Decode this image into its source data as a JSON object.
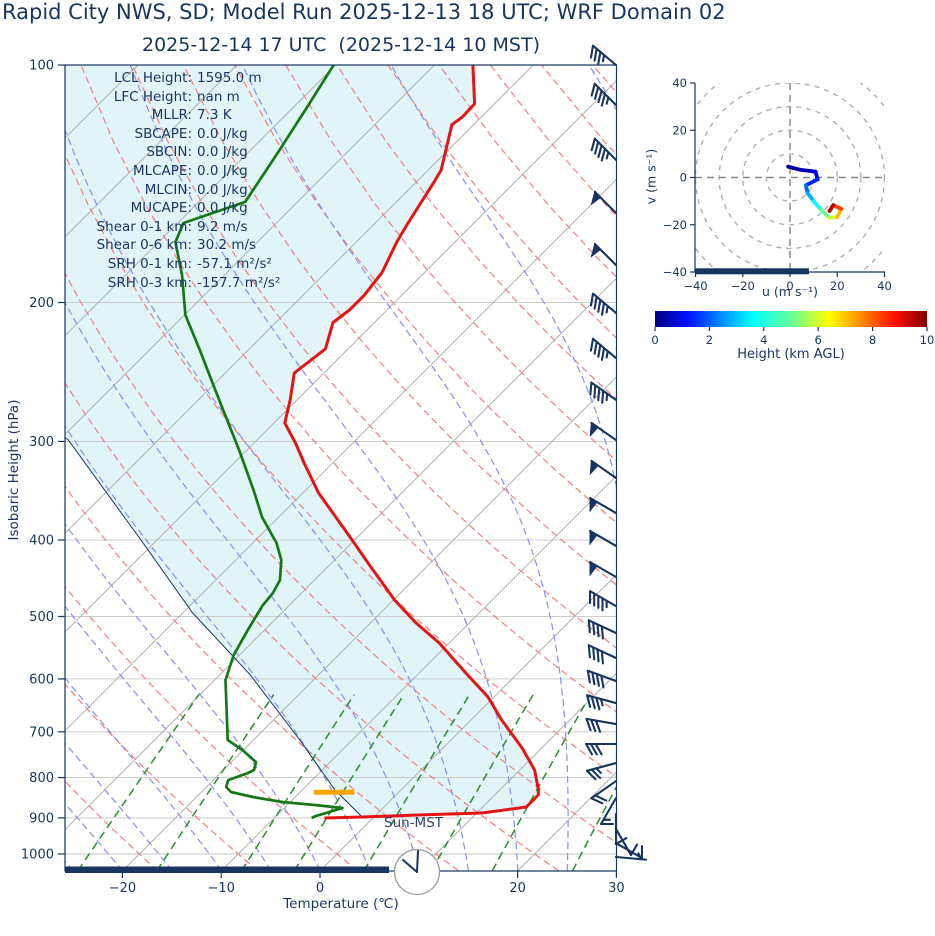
{
  "title": "Rapid City NWS, SD; Model Run 2025-12-13 18 UTC; WRF Domain 02",
  "subtitle": "2025-12-14 17 UTC  (2025-12-14 10 MST)",
  "skewt": {
    "xlabel": "Temperature (℃)",
    "ylabel": "Isobaric Height (hPa)",
    "x_ticks": [
      -20,
      -10,
      0,
      10,
      20,
      30
    ],
    "y_ticks": [
      100,
      200,
      300,
      400,
      500,
      600,
      700,
      800,
      900,
      1000
    ],
    "sun_label": "Sun-MST",
    "stats": [
      {
        "label": "LCL Height:",
        "value": "1595.0 m"
      },
      {
        "label": "LFC Height:",
        "value": "nan m"
      },
      {
        "label": "MLLR:",
        "value": "7.3 K"
      },
      {
        "label": "SBCAPE:",
        "value": "0.0 J/kg"
      },
      {
        "label": "SBCIN:",
        "value": "0.0 J/kg"
      },
      {
        "label": "MLCAPE:",
        "value": "0.0 J/kg"
      },
      {
        "label": "MLCIN:",
        "value": "0.0 J/kg"
      },
      {
        "label": "MUCAPE:",
        "value": "0.0 J/kg"
      },
      {
        "label": "Shear 0-1 km:",
        "value": "9.2 m/s"
      },
      {
        "label": "Shear 0-6 km:",
        "value": "30.2 m/s"
      },
      {
        "label": "SRH 0-1 km:",
        "value": "-57.1 m²/s²"
      },
      {
        "label": "SRH 0-3 km:",
        "value": "-157.7 m²/s²"
      }
    ]
  },
  "hodo": {
    "xlabel": "u (m s⁻¹)",
    "ylabel": "v (m s⁻¹)",
    "ticks": [
      -40,
      -20,
      0,
      20,
      40
    ],
    "range": [
      -40,
      40
    ]
  },
  "colorbar": {
    "ticks": [
      0,
      2,
      4,
      6,
      8,
      10
    ],
    "label": "Height (km AGL)",
    "min": 0,
    "max": 10
  },
  "colors": {
    "navy": "#17355e",
    "fill": "#e1f5f8",
    "isotherm": "#a9a9a9",
    "gridline": "#c6c6c6",
    "dry_adiabat": "#f08080",
    "moist_adiabat": "#8890e8",
    "mixing_line": "#2e8b2e",
    "temperature": "#e51412",
    "dewpoint": "#157815",
    "parcel": "#17355e",
    "lcl": "#ffa500",
    "clock_stroke": "#9a9a9a"
  },
  "chart_data": {
    "type": "line",
    "subtype": "skewt-sounding",
    "pressure_range_hPa": [
      100,
      1050
    ],
    "temp_axis_C": [
      -20,
      -10,
      0,
      10,
      20,
      30
    ],
    "temperature_C": [
      [
        100,
        -66.1
      ],
      [
        112,
        -62.0
      ],
      [
        116.4,
        -61.9
      ],
      [
        119,
        -62.2
      ],
      [
        135.8,
        -58.7
      ],
      [
        140.6,
        -58.2
      ],
      [
        159.5,
        -56.6
      ],
      [
        167.6,
        -55.9
      ],
      [
        183.2,
        -54.3
      ],
      [
        195.7,
        -53.8
      ],
      [
        204.4,
        -53.8
      ],
      [
        212,
        -54.2
      ],
      [
        228.9,
        -52.3
      ],
      [
        245.7,
        -53.0
      ],
      [
        265.7,
        -50.7
      ],
      [
        284.3,
        -48.9
      ],
      [
        301.4,
        -45.8
      ],
      [
        319.5,
        -42.9
      ],
      [
        348.7,
        -38.4
      ],
      [
        397.6,
        -30.6
      ],
      [
        430,
        -26.0
      ],
      [
        476.4,
        -19.9
      ],
      [
        509.5,
        -15.4
      ],
      [
        540.3,
        -11.0
      ],
      [
        589.5,
        -5.3
      ],
      [
        632.5,
        -0.6
      ],
      [
        676.4,
        3.1
      ],
      [
        733.9,
        8.0
      ],
      [
        782.7,
        11.5
      ],
      [
        829.5,
        13.9
      ],
      [
        841.8,
        14.4
      ],
      [
        871.8,
        14.4
      ],
      [
        887.3,
        10.5
      ],
      [
        892.6,
        3.9
      ],
      [
        897.6,
        -1.2
      ],
      [
        900.4,
        -4.9
      ]
    ],
    "dewpoint_C": [
      [
        100,
        -80.2
      ],
      [
        112.4,
        -78.7
      ],
      [
        128.9,
        -77.0
      ],
      [
        149.1,
        -75.3
      ],
      [
        158.6,
        -79.4
      ],
      [
        167.6,
        -78.3
      ],
      [
        184.5,
        -74.3
      ],
      [
        207.4,
        -69.9
      ],
      [
        229.7,
        -64.9
      ],
      [
        265.7,
        -57.9
      ],
      [
        307.6,
        -50.8
      ],
      [
        345.6,
        -45.3
      ],
      [
        374,
        -41.7
      ],
      [
        403.5,
        -37.6
      ],
      [
        424,
        -35.4
      ],
      [
        449.5,
        -33.5
      ],
      [
        466.9,
        -32.9
      ],
      [
        483.6,
        -32.7
      ],
      [
        520.1,
        -31.7
      ],
      [
        559.5,
        -30.6
      ],
      [
        601.8,
        -28.9
      ],
      [
        717,
        -22.6
      ],
      [
        738.3,
        -20.1
      ],
      [
        764.7,
        -17.5
      ],
      [
        782.7,
        -16.9
      ],
      [
        789.5,
        -17.2
      ],
      [
        805.9,
        -18.5
      ],
      [
        822.3,
        -18.0
      ],
      [
        834.6,
        -17.0
      ],
      [
        846.8,
        -14.3
      ],
      [
        859.2,
        -10.8
      ],
      [
        866.8,
        -7.2
      ],
      [
        874.4,
        -4.1
      ],
      [
        890,
        -5.5
      ],
      [
        895,
        -6.0
      ],
      [
        900.4,
        -6.2
      ]
    ],
    "parcel_C": [
      [
        897.6,
        -1.2
      ],
      [
        829.5,
        -6.7
      ],
      [
        717,
        -15.3
      ],
      [
        593,
        -26.9
      ],
      [
        494.9,
        -39.0
      ],
      [
        403.5,
        -51.1
      ],
      [
        298.7,
        -69.1
      ],
      [
        250,
        -84.0
      ],
      [
        200,
        -103.0
      ]
    ],
    "lcl_marker": {
      "pressure_hPa": 835,
      "t_from_C": -8.6,
      "t_to_C": -4.5
    },
    "wind_barbs_p_dir_kt": [
      [
        100,
        310,
        35
      ],
      [
        112.4,
        315,
        45
      ],
      [
        131.9,
        315,
        45
      ],
      [
        154,
        315,
        50
      ],
      [
        179.3,
        315,
        50
      ],
      [
        206.2,
        310,
        45
      ],
      [
        235.2,
        310,
        45
      ],
      [
        265.7,
        305,
        45
      ],
      [
        298.8,
        305,
        50
      ],
      [
        333.8,
        305,
        50
      ],
      [
        369.7,
        300,
        50
      ],
      [
        407,
        300,
        50
      ],
      [
        445.6,
        300,
        50
      ],
      [
        485.1,
        300,
        45
      ],
      [
        524.7,
        295,
        40
      ],
      [
        564.4,
        295,
        40
      ],
      [
        603.6,
        290,
        40
      ],
      [
        643.7,
        285,
        35
      ],
      [
        684.4,
        280,
        30
      ],
      [
        725.4,
        270,
        28
      ],
      [
        766.9,
        255,
        25
      ],
      [
        808.3,
        235,
        20
      ],
      [
        849.3,
        210,
        15
      ],
      [
        890,
        180,
        12
      ],
      [
        929.8,
        150,
        10
      ],
      [
        968.5,
        120,
        8
      ],
      [
        1008.8,
        95,
        5
      ]
    ],
    "hodograph_uvh": [
      [
        -0.8,
        4.6,
        0
      ],
      [
        4.2,
        3.3,
        0.4
      ],
      [
        10.8,
        2.5,
        0.9
      ],
      [
        11.7,
        -0.8,
        1.3
      ],
      [
        6.7,
        -3.3,
        1.9
      ],
      [
        7.5,
        -6.7,
        2.6
      ],
      [
        10,
        -10,
        3.3
      ],
      [
        13.3,
        -13.8,
        4.3
      ],
      [
        16.7,
        -17.1,
        5.3
      ],
      [
        20,
        -16.7,
        6.3
      ],
      [
        21.7,
        -13.3,
        7.6
      ],
      [
        18.3,
        -11.7,
        8.7
      ],
      [
        16.7,
        -14.2,
        10
      ]
    ],
    "hodograph_ground_bar_u": [
      -40,
      8
    ],
    "surface_bar_temp_extent": "left portion of x-axis"
  }
}
